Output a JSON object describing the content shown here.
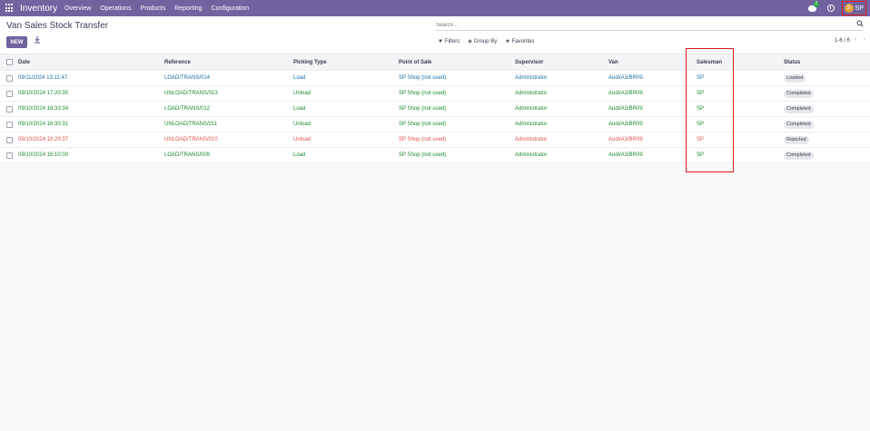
{
  "navbar": {
    "brand": "Inventory",
    "menu": [
      "Overview",
      "Operations",
      "Products",
      "Reporting",
      "Configuration"
    ],
    "chat_count": "2",
    "user_avatar_letter": "S",
    "user_initials": "SP"
  },
  "control": {
    "title": "Van Sales Stock Transfer",
    "new_label": "NEW",
    "search_placeholder": "Search...",
    "filters_label": "Filters",
    "group_by_label": "Group By",
    "favorites_label": "Favorites",
    "pager": "1-6 / 6"
  },
  "table": {
    "columns": [
      "Date",
      "Reference",
      "Picking Type",
      "Point of Sale",
      "Supervisor",
      "Van",
      "Salesman",
      "Status"
    ],
    "rows": [
      {
        "date": "09/11/2024 13:11:47",
        "reference": "LOAD/TRANS/014",
        "picking_type": "Load",
        "pos": "SP Shop (not used)",
        "supervisor": "Administrator",
        "van": "Audi/A3/BR09",
        "salesman": "SP",
        "status": "Loaded",
        "tone": "blue"
      },
      {
        "date": "09/10/2024 17:20:35",
        "reference": "UNLOAD/TRANS/013",
        "picking_type": "Unload",
        "pos": "SP Shop (not used)",
        "supervisor": "Administrator",
        "van": "Audi/A3/BR09",
        "salesman": "SP",
        "status": "Completed",
        "tone": "green"
      },
      {
        "date": "09/10/2024 16:33:34",
        "reference": "LOAD/TRANS/012",
        "picking_type": "Load",
        "pos": "SP Shop (not used)",
        "supervisor": "Administrator",
        "van": "Audi/A3/BR09",
        "salesman": "SP",
        "status": "Completed",
        "tone": "green"
      },
      {
        "date": "09/10/2024 16:30:31",
        "reference": "UNLOAD/TRANS/011",
        "picking_type": "Unload",
        "pos": "SP Shop (not used)",
        "supervisor": "Administrator",
        "van": "Audi/A3/BR09",
        "salesman": "SP",
        "status": "Completed",
        "tone": "green"
      },
      {
        "date": "09/10/2024 16:29:37",
        "reference": "UNLOAD/TRANS/010",
        "picking_type": "Unload",
        "pos": "SP Shop (not used)",
        "supervisor": "Administrator",
        "van": "Audi/A3/BR09",
        "salesman": "SP",
        "status": "Rejected",
        "tone": "red"
      },
      {
        "date": "09/10/2024 16:10:00",
        "reference": "LOAD/TRANS/009",
        "picking_type": "Load",
        "pos": "SP Shop (not used)",
        "supervisor": "Administrator",
        "van": "Audi/A3/BR09",
        "salesman": "SP",
        "status": "Completed",
        "tone": "green"
      }
    ]
  },
  "colors": {
    "navbar": "#71639e",
    "highlight": "#e01919",
    "green_text": "#1a8a2e",
    "blue_text": "#1b6fa8",
    "red_text": "#d9534f"
  },
  "icons": [
    "apps-grid-icon",
    "chat-icon",
    "clock-icon",
    "download-icon",
    "search-icon",
    "filter-icon",
    "layers-icon",
    "star-icon",
    "chevron-left-icon",
    "chevron-right-icon"
  ]
}
